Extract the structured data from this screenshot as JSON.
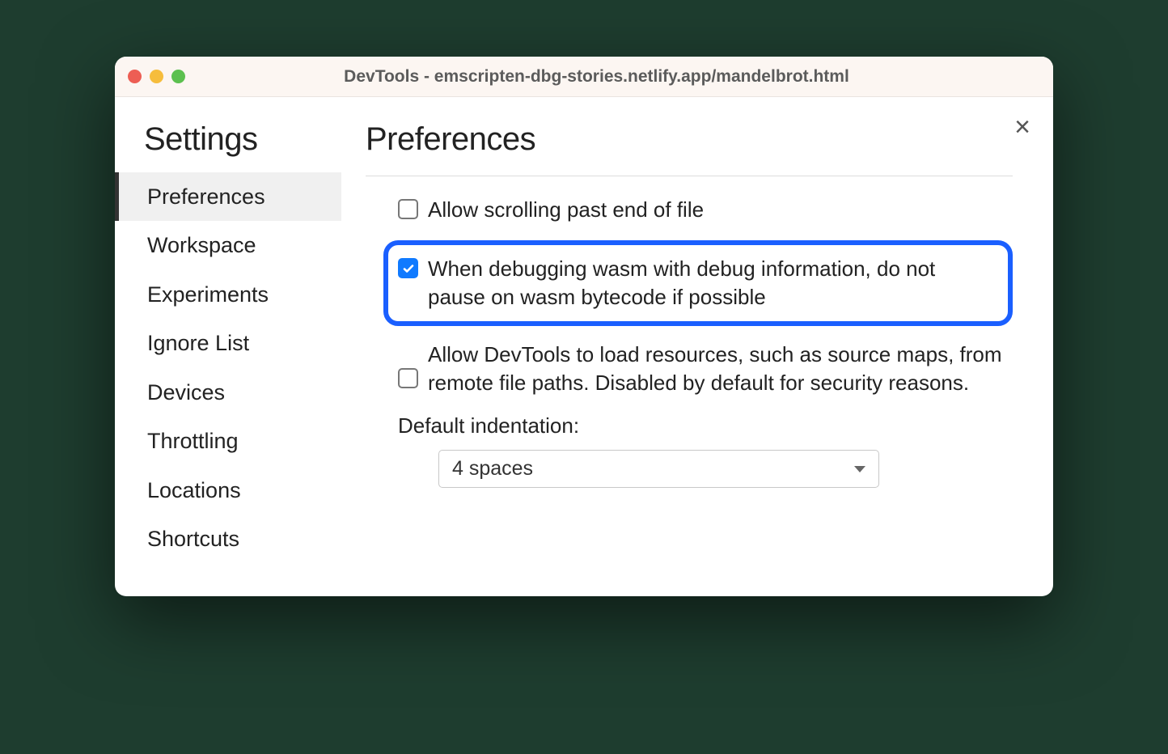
{
  "window": {
    "title": "DevTools - emscripten-dbg-stories.netlify.app/mandelbrot.html"
  },
  "close_label": "×",
  "sidebar": {
    "title": "Settings",
    "items": [
      {
        "label": "Preferences",
        "active": true
      },
      {
        "label": "Workspace",
        "active": false
      },
      {
        "label": "Experiments",
        "active": false
      },
      {
        "label": "Ignore List",
        "active": false
      },
      {
        "label": "Devices",
        "active": false
      },
      {
        "label": "Throttling",
        "active": false
      },
      {
        "label": "Locations",
        "active": false
      },
      {
        "label": "Shortcuts",
        "active": false
      }
    ]
  },
  "main": {
    "title": "Preferences",
    "checks": [
      {
        "label": "Allow scrolling past end of file",
        "checked": false,
        "highlight": false
      },
      {
        "label": "When debugging wasm with debug information, do not pause on wasm bytecode if possible",
        "checked": true,
        "highlight": true
      },
      {
        "label": "Allow DevTools to load resources, such as source maps, from remote file paths. Disabled by default for security reasons.",
        "checked": false,
        "highlight": false
      }
    ],
    "indent": {
      "label": "Default indentation:",
      "value": "4 spaces"
    }
  }
}
